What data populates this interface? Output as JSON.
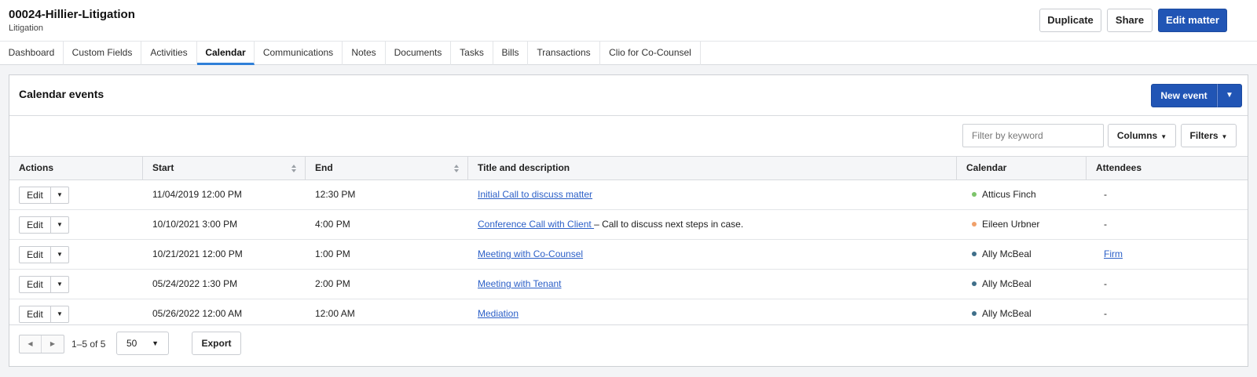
{
  "header": {
    "title": "00024-Hillier-Litigation",
    "subtitle": "Litigation",
    "duplicate_label": "Duplicate",
    "share_label": "Share",
    "edit_label": "Edit matter"
  },
  "tabs": [
    {
      "label": "Dashboard"
    },
    {
      "label": "Custom Fields"
    },
    {
      "label": "Activities"
    },
    {
      "label": "Calendar",
      "active": true
    },
    {
      "label": "Communications"
    },
    {
      "label": "Notes"
    },
    {
      "label": "Documents"
    },
    {
      "label": "Tasks"
    },
    {
      "label": "Bills"
    },
    {
      "label": "Transactions"
    },
    {
      "label": "Clio for Co-Counsel"
    }
  ],
  "panel": {
    "title": "Calendar events",
    "new_event_label": "New event",
    "filter_placeholder": "Filter by keyword",
    "columns_label": "Columns",
    "filters_label": "Filters"
  },
  "table": {
    "headers": {
      "actions": "Actions",
      "start": "Start",
      "end": "End",
      "title": "Title and description",
      "calendar": "Calendar",
      "attendees": "Attendees"
    },
    "edit_label": "Edit",
    "rows": [
      {
        "start": "11/04/2019 12:00 PM",
        "end": "12:30 PM",
        "title": "Initial Call to discuss matter",
        "description": "",
        "calendar": "Atticus Finch",
        "calendar_color": "#7dc46b",
        "attendees": "-",
        "attendees_link": false
      },
      {
        "start": "10/10/2021 3:00 PM",
        "end": "4:00 PM",
        "title": "Conference Call with Client ",
        "description": "– Call to discuss next steps in case.",
        "calendar": "Eileen Urbner",
        "calendar_color": "#f0a06a",
        "attendees": "-",
        "attendees_link": false
      },
      {
        "start": "10/21/2021 12:00 PM",
        "end": "1:00 PM",
        "title": "Meeting with Co-Counsel",
        "description": "",
        "calendar": "Ally McBeal",
        "calendar_color": "#3f6f8a",
        "attendees": "Firm",
        "attendees_link": true
      },
      {
        "start": "05/24/2022 1:30 PM",
        "end": "2:00 PM",
        "title": "Meeting with Tenant",
        "description": "",
        "calendar": "Ally McBeal",
        "calendar_color": "#3f6f8a",
        "attendees": "-",
        "attendees_link": false
      },
      {
        "start": "05/26/2022 12:00 AM",
        "end": "12:00 AM",
        "title": "Mediation",
        "description": "",
        "calendar": "Ally McBeal",
        "calendar_color": "#3f6f8a",
        "attendees": "-",
        "attendees_link": false
      }
    ]
  },
  "footer": {
    "range_text": "1–5 of 5",
    "per_page": "50",
    "export_label": "Export"
  },
  "colors": {
    "primary": "#2155b5",
    "link": "#2b5fc7",
    "active_tab": "#2f7fd8"
  }
}
